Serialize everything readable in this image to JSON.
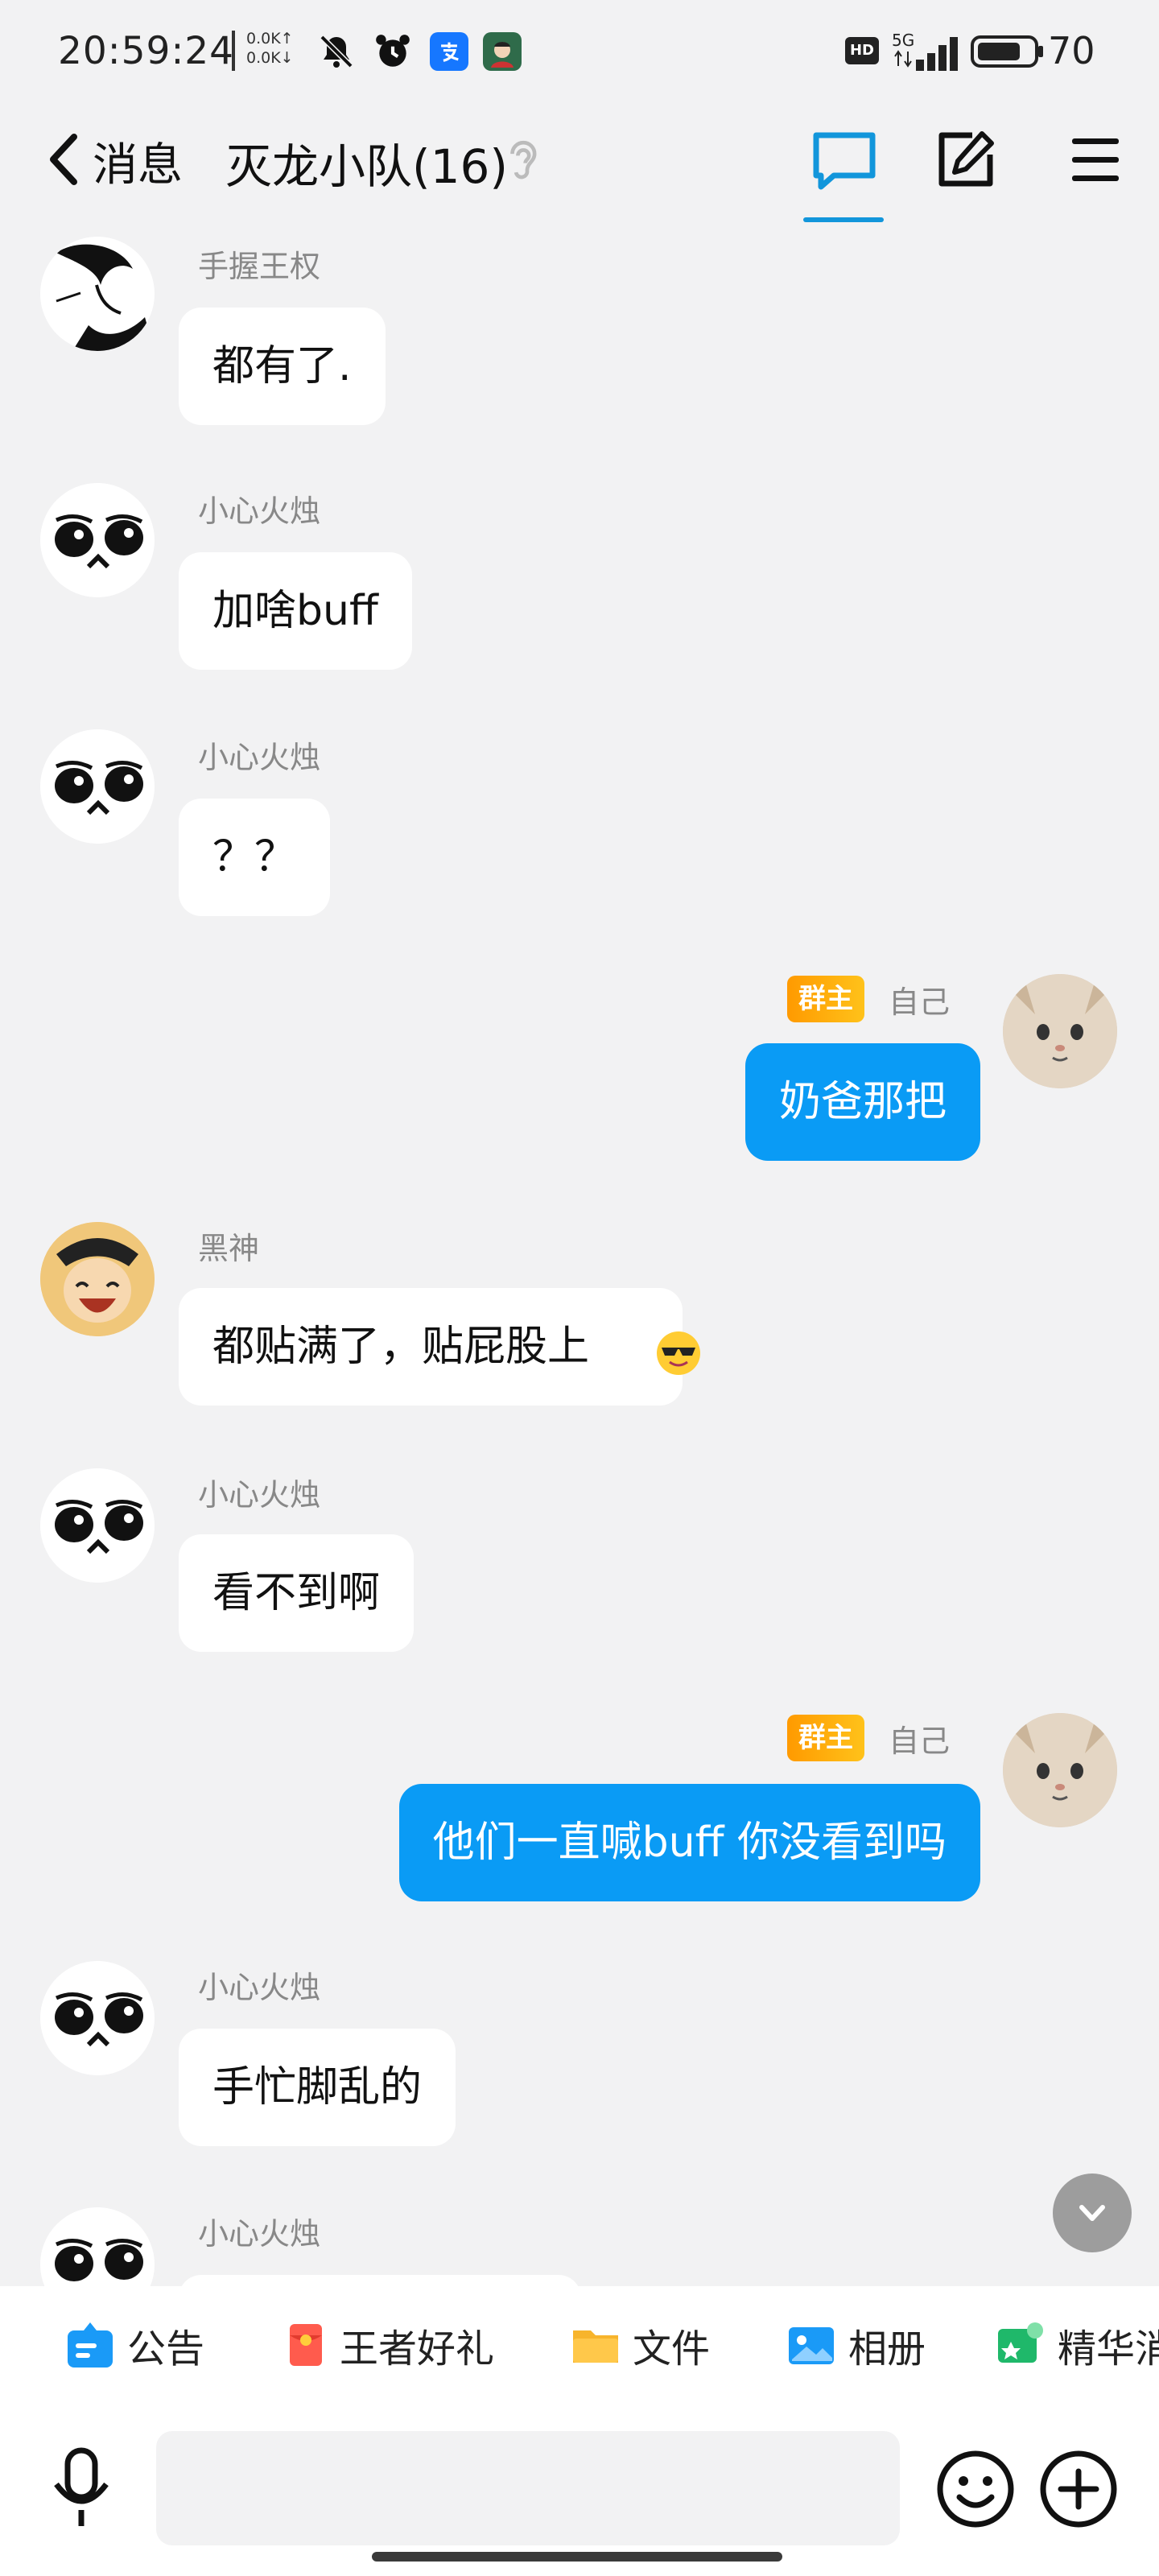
{
  "status_bar": {
    "time": "20:59:24",
    "net_up": "0.0K↑",
    "net_down": "0.0K↓",
    "hd": "HD",
    "signal_label": "5G",
    "battery": "70"
  },
  "header": {
    "back_label": "消息",
    "title": "灭龙小队(16)"
  },
  "messages": [
    {
      "sender": "手握王权",
      "text": "都有了."
    },
    {
      "sender": "小心火烛",
      "text": "加啥buff"
    },
    {
      "sender": "小心火烛",
      "text": "？？"
    },
    {
      "sender": "自己",
      "badge": "群主",
      "text": "奶爸那把"
    },
    {
      "sender": "黑神",
      "text": "都贴满了，贴屁股上"
    },
    {
      "sender": "小心火烛",
      "text": "看不到啊"
    },
    {
      "sender": "自己",
      "badge": "群主",
      "text": "他们一直喊buff  你没看到吗"
    },
    {
      "sender": "小心火烛",
      "text": "手忙脚乱的"
    },
    {
      "sender": "小心火烛",
      "text": ""
    }
  ],
  "toolbar": {
    "items": [
      "公告",
      "王者好礼",
      "文件",
      "相册",
      "精华消"
    ]
  },
  "input": {
    "value": ""
  },
  "colors": {
    "accent": "#1296db",
    "my_bubble": "#0a9bf5",
    "badge": "#ff9a00",
    "background": "#f2f2f3"
  }
}
